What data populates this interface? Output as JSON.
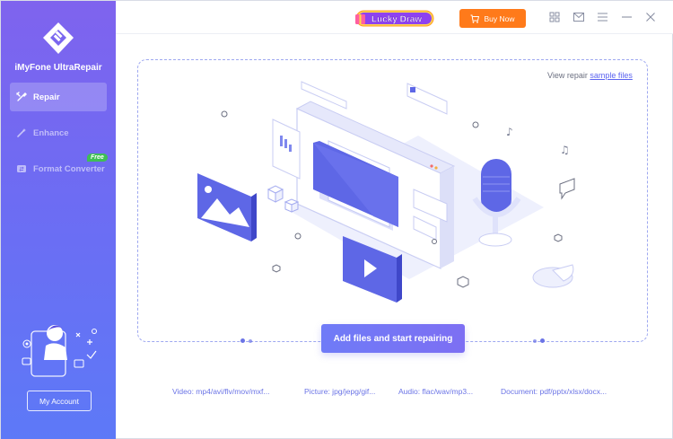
{
  "app": {
    "name": "iMyFone UltraRepair"
  },
  "sidebar": {
    "items": [
      {
        "label": "Repair",
        "icon": "tools-icon"
      },
      {
        "label": "Enhance",
        "icon": "magic-wand-icon"
      },
      {
        "label": "Format Converter",
        "icon": "convert-icon"
      }
    ],
    "free_badge": "Free",
    "account_label": "My Account"
  },
  "titlebar": {
    "lucky_draw": "Lucky Draw",
    "buy_label": "Buy Now",
    "icons": [
      "grid-icon",
      "mail-icon",
      "menu-icon",
      "minimize-icon",
      "close-icon"
    ]
  },
  "main": {
    "view_repair_prefix": "View repair",
    "view_repair_link": "sample files",
    "add_button": "Add files and start repairing",
    "formats": {
      "video": "Video: mp4/avi/flv/mov/mxf...",
      "picture": "Picture: jpg/jepg/gif...",
      "audio": "Audio: flac/wav/mp3...",
      "document": "Document: pdf/pptx/xlsx/docx..."
    }
  },
  "colors": {
    "sidebar_top": "#7f63ee",
    "sidebar_bottom": "#5d79f7",
    "accent": "#6b74e6",
    "buy": "#ff7a1a",
    "free": "#3fbe56"
  }
}
